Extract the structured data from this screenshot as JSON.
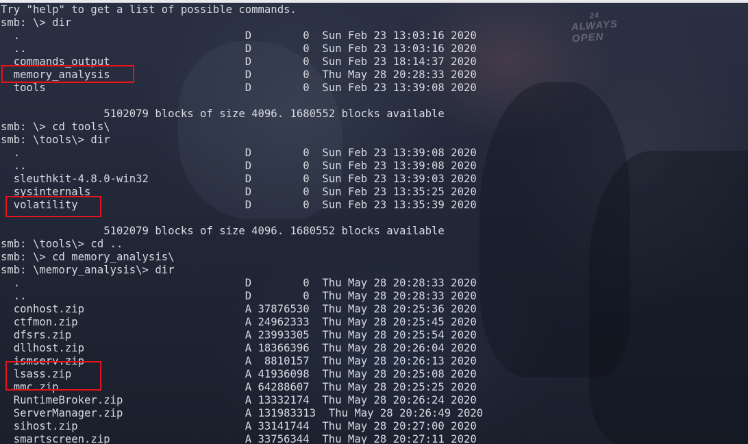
{
  "terminal": {
    "lines": [
      "Try \"help\" to get a list of possible commands.",
      "smb: \\> dir",
      "  .                                   D        0  Sun Feb 23 13:03:16 2020",
      "  ..                                  D        0  Sun Feb 23 13:03:16 2020",
      "  commands_output                     D        0  Sun Feb 23 18:14:37 2020",
      "  memory_analysis                     D        0  Thu May 28 20:28:33 2020",
      "  tools                               D        0  Sun Feb 23 13:39:08 2020",
      "",
      "                5102079 blocks of size 4096. 1680552 blocks available",
      "smb: \\> cd tools\\",
      "smb: \\tools\\> dir",
      "  .                                   D        0  Sun Feb 23 13:39:08 2020",
      "  ..                                  D        0  Sun Feb 23 13:39:08 2020",
      "  sleuthkit-4.8.0-win32               D        0  Sun Feb 23 13:39:03 2020",
      "  sysinternals                        D        0  Sun Feb 23 13:35:25 2020",
      "  volatility                          D        0  Sun Feb 23 13:35:39 2020",
      "",
      "                5102079 blocks of size 4096. 1680552 blocks available",
      "smb: \\tools\\> cd ..",
      "smb: \\> cd memory_analysis\\",
      "smb: \\memory_analysis\\> dir",
      "  .                                   D        0  Thu May 28 20:28:33 2020",
      "  ..                                  D        0  Thu May 28 20:28:33 2020",
      "  conhost.zip                         A 37876530  Thu May 28 20:25:36 2020",
      "  ctfmon.zip                          A 24962333  Thu May 28 20:25:45 2020",
      "  dfsrs.zip                           A 23993305  Thu May 28 20:25:54 2020",
      "  dllhost.zip                         A 18366396  Thu May 28 20:26:04 2020",
      "  ismserv.zip                         A  8810157  Thu May 28 20:26:13 2020",
      "  lsass.zip                           A 41936098  Thu May 28 20:25:08 2020",
      "  mmc.zip                             A 64288607  Thu May 28 20:25:25 2020",
      "  RuntimeBroker.zip                   A 13332174  Thu May 28 20:26:24 2020",
      "  ServerManager.zip                   A 131983313  Thu May 28 20:26:49 2020",
      "  sihost.zip                          A 33141744  Thu May 28 20:27:00 2020",
      "  smartscreen.zip                     A 33756344  Thu May 28 20:27:11 2020"
    ]
  },
  "background": {
    "sign_line1": "24",
    "sign_line2": "ALWAYS",
    "sign_line3": "OPEN"
  },
  "colors": {
    "text": "#d8dbe2",
    "highlight_border": "#e8121a"
  }
}
